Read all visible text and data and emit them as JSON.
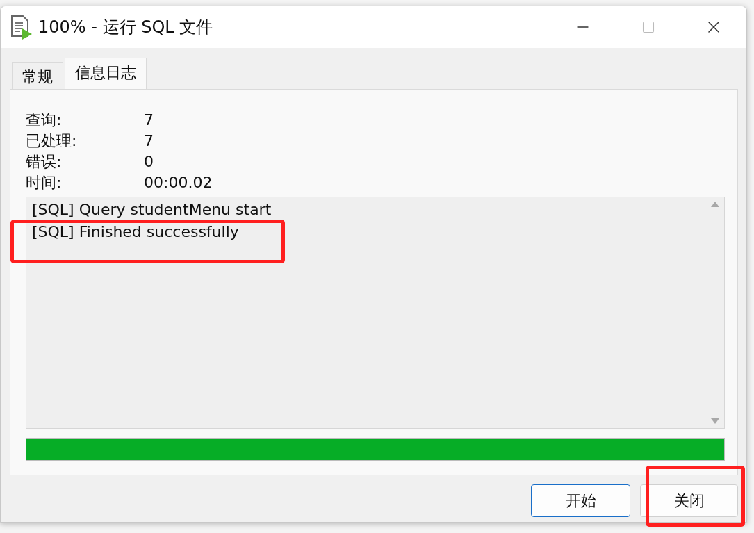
{
  "window": {
    "title": "100% - 运行 SQL 文件"
  },
  "tabs": [
    {
      "label": "常规",
      "selected": false
    },
    {
      "label": "信息日志",
      "selected": true
    }
  ],
  "stats": [
    {
      "label": "查询:",
      "value": "7"
    },
    {
      "label": "已处理:",
      "value": "7"
    },
    {
      "label": "错误:",
      "value": "0"
    },
    {
      "label": "时间:",
      "value": "00:00.02"
    }
  ],
  "log": {
    "lines": [
      "[SQL] Query studentMenu start",
      "[SQL] Finished successfully"
    ],
    "highlighted": true
  },
  "progress": {
    "level": 1
  },
  "buttons": [
    {
      "label": "开始",
      "selected": true,
      "highlighted": false
    },
    {
      "label": "关闭",
      "selected": false,
      "highlighted": true
    }
  ]
}
